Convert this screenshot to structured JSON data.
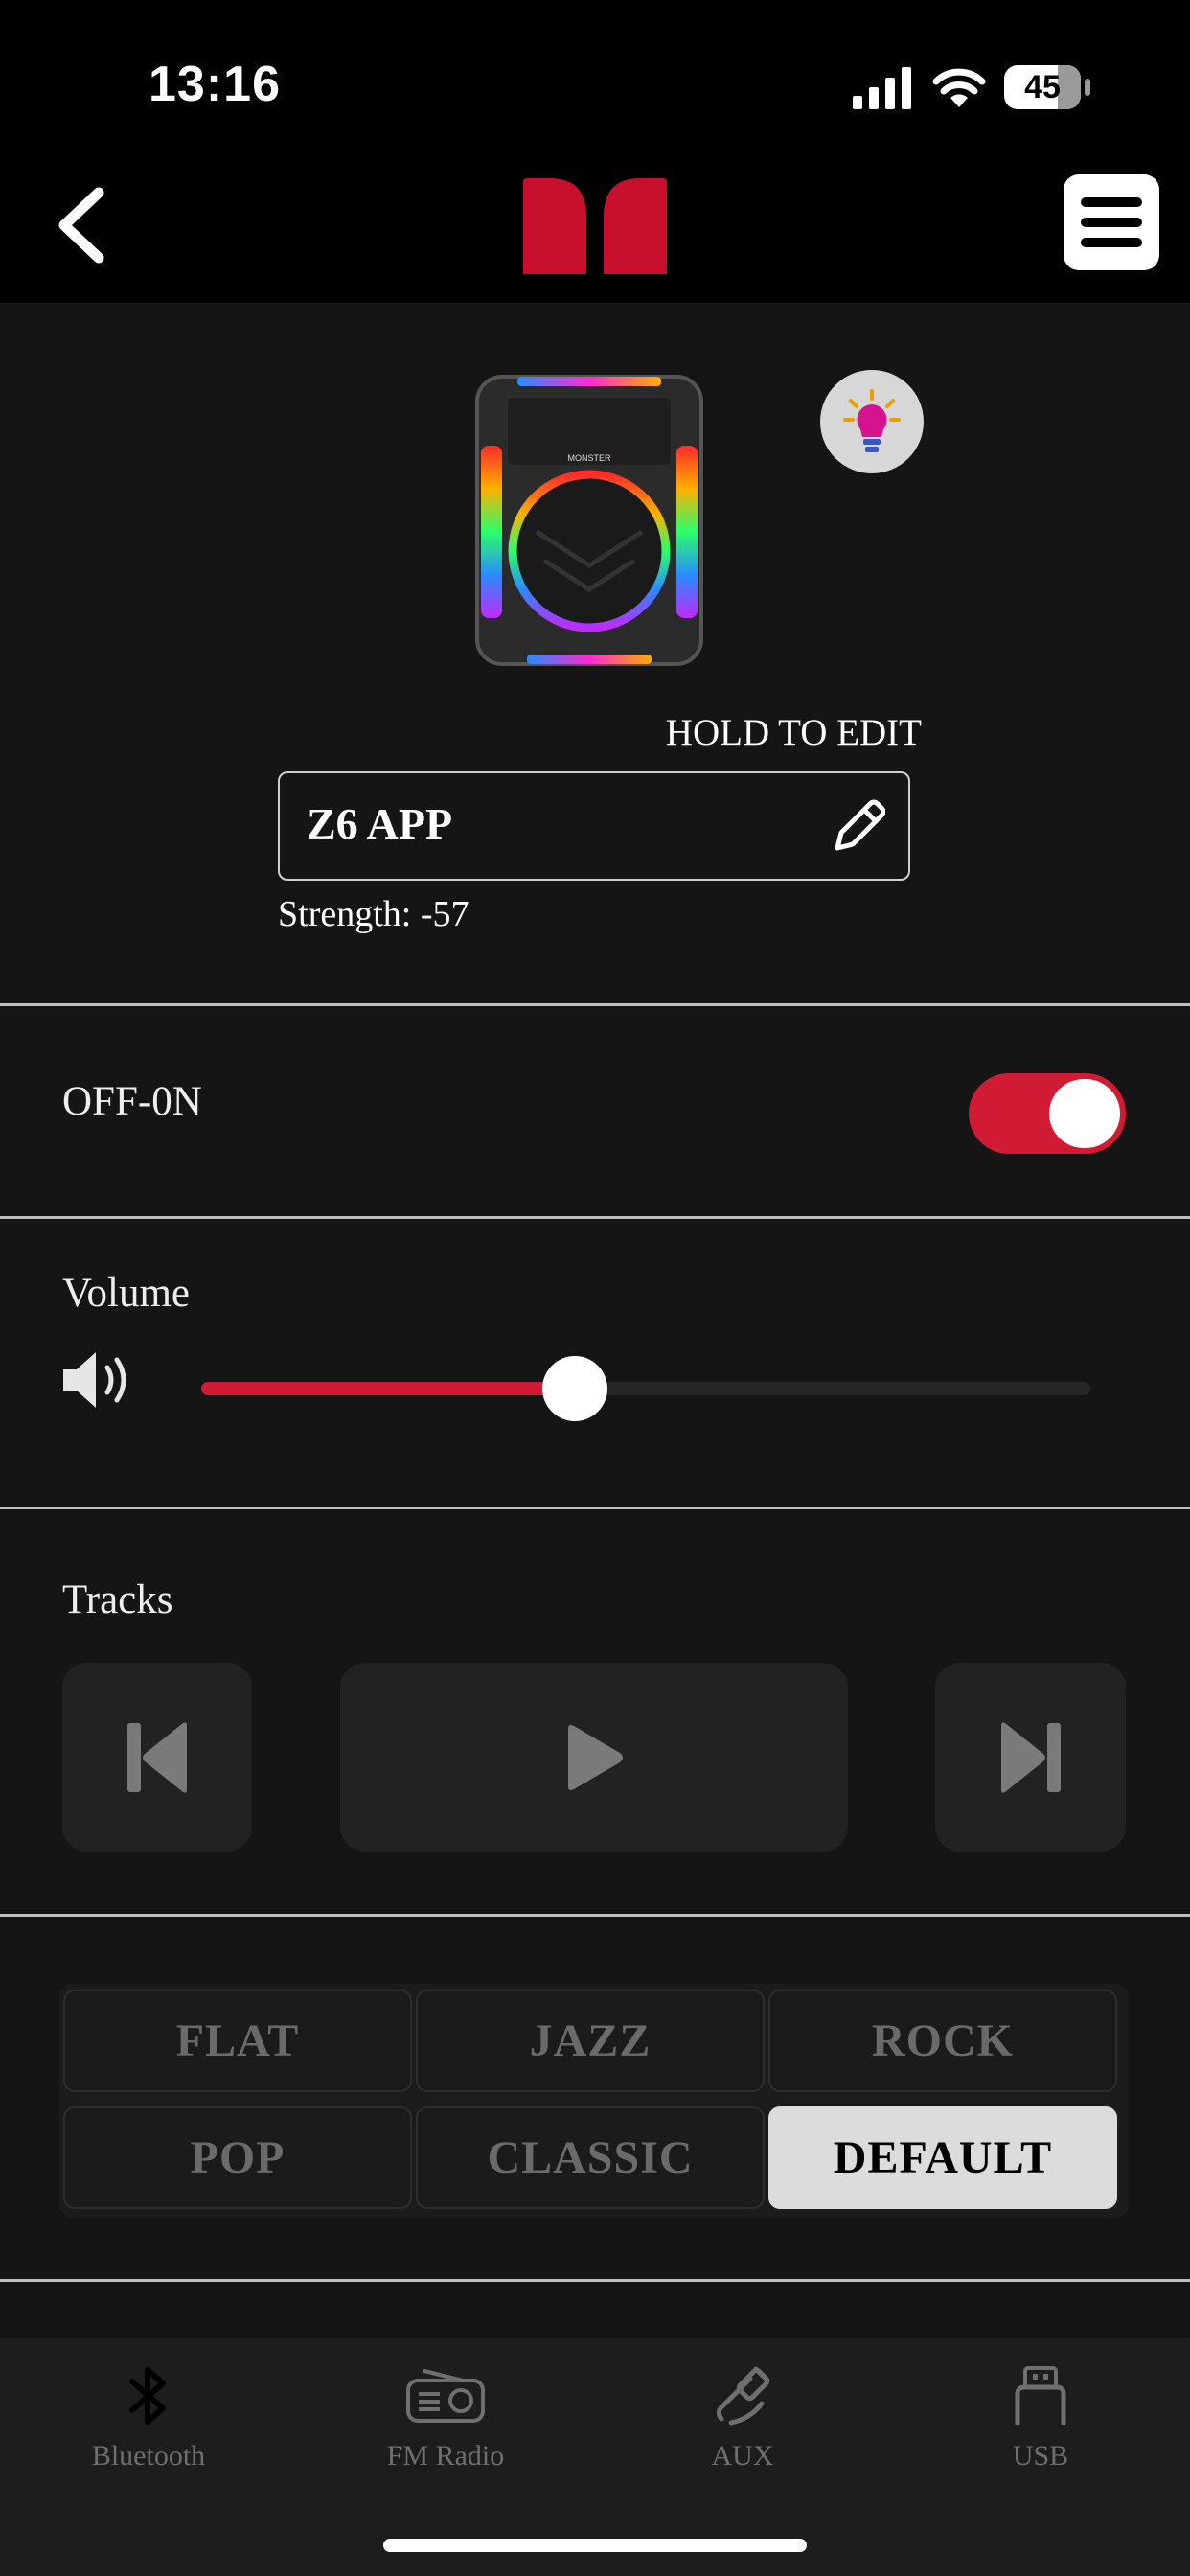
{
  "status_bar": {
    "time": "13:16",
    "battery": "45"
  },
  "header": {
    "back_icon": "chevron-left-icon",
    "logo": "monster-logo",
    "menu_icon": "hamburger-menu-icon"
  },
  "device": {
    "hold_to_edit": "HOLD TO EDIT",
    "name": "Z6 APP",
    "strength": "Strength: -57",
    "light_button_icon": "lightbulb-icon"
  },
  "power": {
    "label": "OFF-0N",
    "on": true,
    "accent": "#d11a33"
  },
  "volume": {
    "label": "Volume",
    "level": 0.42
  },
  "tracks": {
    "label": "Tracks"
  },
  "eq": {
    "presets": [
      "FLAT",
      "JAZZ",
      "ROCK",
      "POP",
      "CLASSIC",
      "DEFAULT"
    ],
    "selected": "DEFAULT"
  },
  "tabs": [
    {
      "label": "Bluetooth",
      "icon": "bluetooth-icon",
      "active": true
    },
    {
      "label": "FM Radio",
      "icon": "radio-icon",
      "active": false
    },
    {
      "label": "AUX",
      "icon": "aux-cable-icon",
      "active": false
    },
    {
      "label": "USB",
      "icon": "usb-icon",
      "active": false
    }
  ]
}
